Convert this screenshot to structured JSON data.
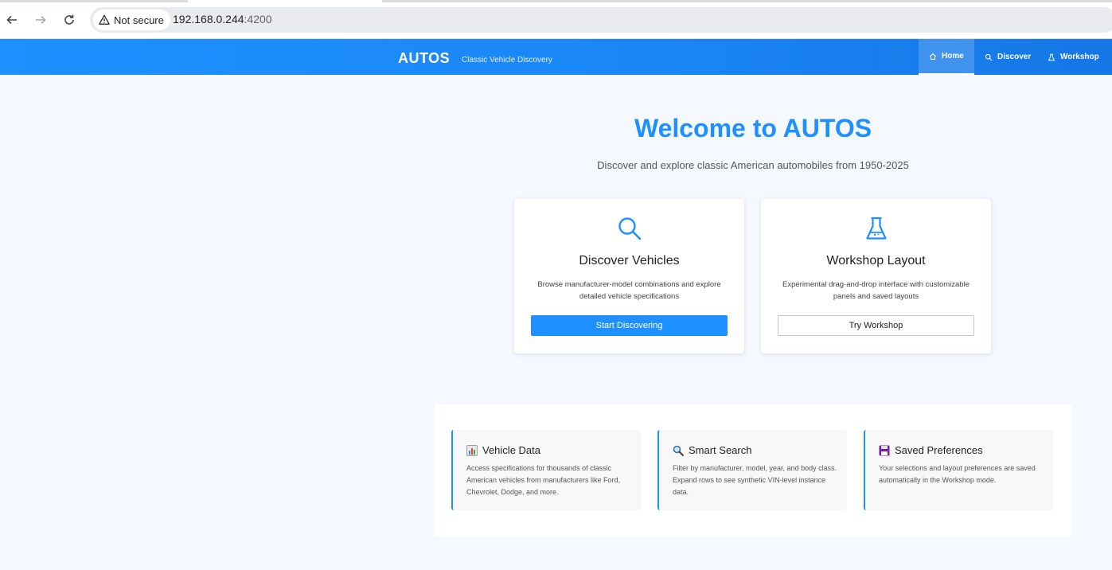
{
  "browser": {
    "security_label": "Not secure",
    "url_host": "192.168.0.244",
    "url_port": ":4200"
  },
  "header": {
    "brand": "AUTOS",
    "tagline": "Classic Vehicle Discovery",
    "nav": [
      {
        "label": "Home",
        "icon": "home-icon",
        "active": true
      },
      {
        "label": "Discover",
        "icon": "search-icon",
        "active": false
      },
      {
        "label": "Workshop",
        "icon": "flask-icon",
        "active": false
      }
    ]
  },
  "hero": {
    "title": "Welcome to AUTOS",
    "subtitle": "Discover and explore classic American automobiles from 1950-2025"
  },
  "cards": [
    {
      "icon": "search-icon",
      "title": "Discover Vehicles",
      "description": "Browse manufacturer-model combinations and explore detailed vehicle specifications",
      "button": "Start Discovering"
    },
    {
      "icon": "flask-icon",
      "title": "Workshop Layout",
      "description": "Experimental drag-and-drop interface with customizable panels and saved layouts",
      "button": "Try Workshop"
    }
  ],
  "features": [
    {
      "icon": "bar-chart-icon",
      "title": "Vehicle Data",
      "description": "Access specifications for thousands of classic American vehicles from manufacturers like Ford, Chevrolet, Dodge, and more."
    },
    {
      "icon": "magnifier-icon",
      "title": "Smart Search",
      "description": "Filter by manufacturer, model, year, and body class. Expand rows to see synthetic VIN-level instance data."
    },
    {
      "icon": "floppy-disk-icon",
      "title": "Saved Preferences",
      "description": "Your selections and layout preferences are saved automatically in the Workshop mode."
    }
  ],
  "colors": {
    "accent": "#1e90ff",
    "page_background": "#f5f9ff"
  }
}
